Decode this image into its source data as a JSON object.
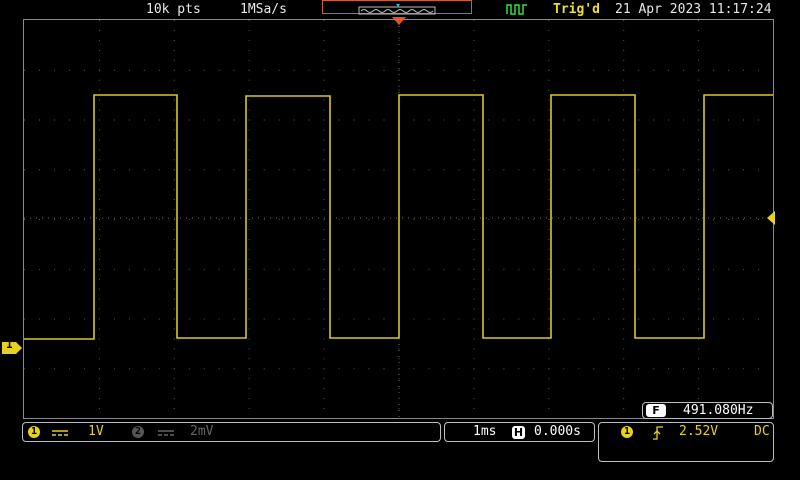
{
  "header": {
    "record_length": "10k pts",
    "sample_rate": "1MSa/s",
    "trigger_status": "Trig'd",
    "datetime": "21 Apr 2023 11:17:24"
  },
  "markers": {
    "ch1_marker": "1"
  },
  "measurement": {
    "badge": "F",
    "frequency": "491.080Hz"
  },
  "channels": {
    "ch1": {
      "badge": "1",
      "coupling_icon": "dc-coupling-icon",
      "scale": "1V"
    },
    "ch2": {
      "badge": "2",
      "coupling_icon": "dc-coupling-icon",
      "scale": "2mV"
    }
  },
  "timebase": {
    "scale": "1ms",
    "position_icon": "H",
    "position": "0.000s"
  },
  "trigger": {
    "source_badge": "1",
    "slope_icon": "rising-edge-icon",
    "level": "2.52V",
    "coupling": "DC"
  },
  "colors": {
    "ch1": "#e6d020",
    "trigger_marker": "#e85020",
    "grid": "#8a8a8a",
    "run_icon": "#30e040"
  }
}
